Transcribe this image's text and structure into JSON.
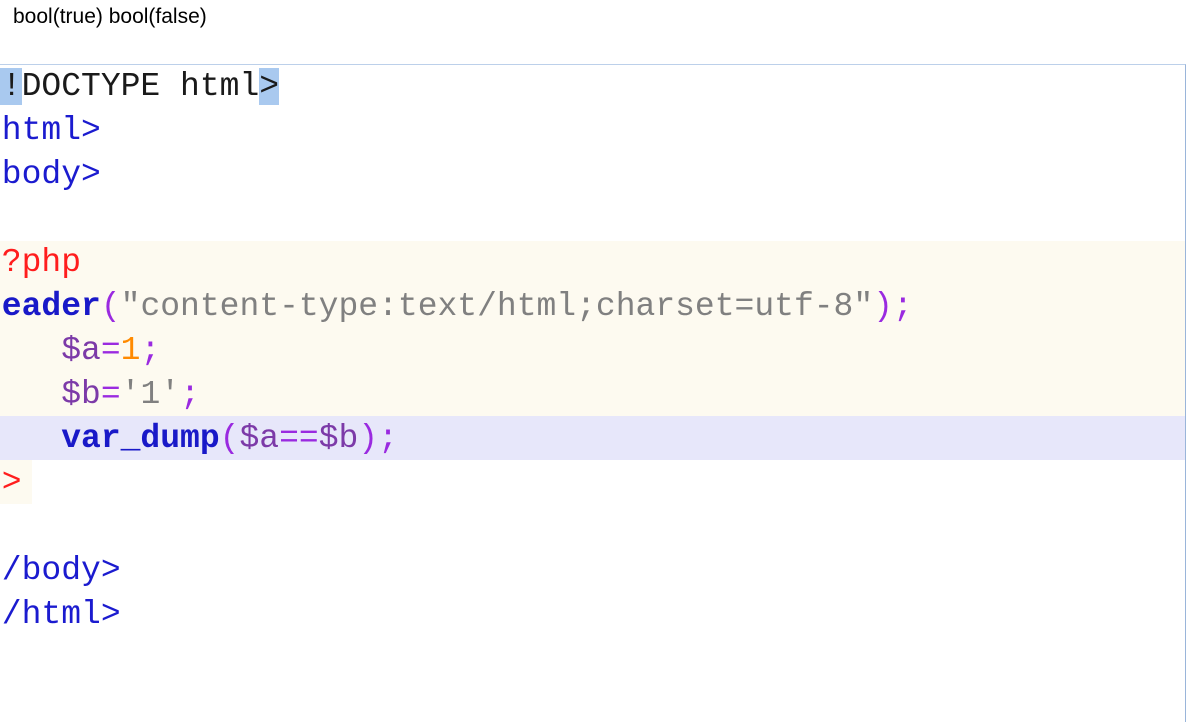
{
  "output": {
    "text": "bool(true) bool(false)"
  },
  "editor": {
    "lines": [
      {
        "parts": [
          {
            "t": "<!",
            "c": "doctype",
            "h": true
          },
          {
            "t": "DOCTYPE html",
            "c": "doctype"
          },
          {
            "t": ">",
            "c": "doctype",
            "h": true
          }
        ]
      },
      {
        "parts": [
          {
            "t": "<html>",
            "c": "tag"
          }
        ]
      },
      {
        "parts": [
          {
            "t": "<body>",
            "c": "tag"
          }
        ]
      },
      {
        "parts": []
      },
      {
        "parts": [
          {
            "t": "<?php",
            "c": "php"
          }
        ]
      },
      {
        "parts": [
          {
            "t": "header",
            "c": "func"
          },
          {
            "t": "(",
            "c": "punc"
          },
          {
            "t": "\"content-type:text/html;charset=utf-8\"",
            "c": "str"
          },
          {
            "t": ");",
            "c": "punc"
          }
        ]
      },
      {
        "parts": [
          {
            "t": "    ",
            "c": "plain"
          },
          {
            "t": "$a",
            "c": "var"
          },
          {
            "t": "=",
            "c": "op"
          },
          {
            "t": "1",
            "c": "num"
          },
          {
            "t": ";",
            "c": "punc"
          }
        ]
      },
      {
        "parts": [
          {
            "t": "    ",
            "c": "plain"
          },
          {
            "t": "$b",
            "c": "var"
          },
          {
            "t": "=",
            "c": "op"
          },
          {
            "t": "'1'",
            "c": "str"
          },
          {
            "t": ";",
            "c": "punc"
          }
        ]
      },
      {
        "parts": [
          {
            "t": "    ",
            "c": "plain"
          },
          {
            "t": "var_dump",
            "c": "func"
          },
          {
            "t": "(",
            "c": "punc"
          },
          {
            "t": "$a",
            "c": "var"
          },
          {
            "t": "==",
            "c": "op"
          },
          {
            "t": "$b",
            "c": "var"
          },
          {
            "t": ");",
            "c": "punc"
          }
        ]
      },
      {
        "parts": [
          {
            "t": "?>",
            "c": "php"
          }
        ]
      },
      {
        "parts": []
      },
      {
        "parts": [
          {
            "t": "</body>",
            "c": "tag"
          }
        ]
      },
      {
        "parts": [
          {
            "t": "</html>",
            "c": "tag"
          }
        ]
      }
    ]
  }
}
